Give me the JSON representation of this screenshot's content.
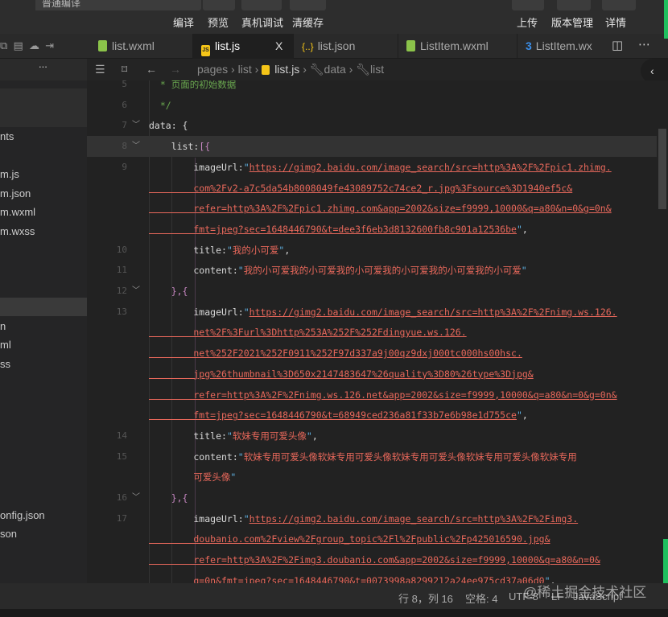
{
  "toolbar": {
    "mode": "普通编译",
    "buttons": [
      "编译",
      "预览",
      "真机调试",
      "清缓存"
    ],
    "right_buttons": [
      "上传",
      "版本管理",
      "详情"
    ]
  },
  "tabs": [
    {
      "label": "list.wxml",
      "icon": "wxml-file-icon",
      "color": "#8bc34a"
    },
    {
      "label": "list.js",
      "icon": "js-file-icon",
      "color": "#f5c518",
      "active": true
    },
    {
      "label": "list.json",
      "icon": "json-file-icon",
      "color": "#f5c518"
    },
    {
      "label": "ListItem.wxml",
      "icon": "wxml-file-icon",
      "color": "#8bc34a"
    },
    {
      "label": "ListItem.wx",
      "icon": "css-file-icon",
      "color": "#3b8ee8"
    }
  ],
  "tab_close": "X",
  "breadcrumb": [
    "pages",
    "list",
    "list.js",
    "data",
    "list"
  ],
  "sidebar": {
    "more": "...",
    "items": [
      "nts",
      "m.js",
      "m.json",
      "m.wxml",
      "m.wxss",
      "n",
      "ml",
      "ss",
      "onfig.json",
      "son"
    ]
  },
  "code": [
    {
      "n": "5",
      "t": [
        [
          "c",
          "  * 页面的初始数据"
        ]
      ]
    },
    {
      "n": "6",
      "t": [
        [
          "c",
          "  */"
        ]
      ]
    },
    {
      "n": "7",
      "f": true,
      "t": [
        [
          "p",
          "data: {"
        ]
      ]
    },
    {
      "n": "8",
      "f": true,
      "cur": true,
      "t": [
        [
          "p",
          "    list:"
        ],
        [
          "b",
          "[{"
        ]
      ]
    },
    {
      "n": "9",
      "t": [
        [
          "k",
          "        imageUrl:"
        ],
        [
          "q",
          "\""
        ],
        [
          "s",
          "https://gimg2.baidu.com/image_search/src=http%3A%2F%2Fpic1.zhimg."
        ]
      ]
    },
    {
      "t": [
        [
          "s",
          "        com%2Fv2-a7c5da54b8008049fe43089752c74ce2_r.jpg%3Fsource%3D1940ef5c&"
        ]
      ]
    },
    {
      "t": [
        [
          "s",
          "        refer=http%3A%2F%2Fpic1.zhimg.com&app=2002&size=f9999,10000&q=a80&n=0&g=0n&"
        ]
      ]
    },
    {
      "t": [
        [
          "s",
          "        fmt=jpeg?sec=1648446790&t=dee3f6eb3d8132600fb8c901a12536be"
        ],
        [
          "q",
          "\""
        ],
        [
          "p",
          ","
        ]
      ]
    },
    {
      "n": "10",
      "t": [
        [
          "k",
          "        title:"
        ],
        [
          "q",
          "\""
        ],
        [
          "sq",
          "我的小可爱"
        ],
        [
          "q",
          "\""
        ],
        [
          "p",
          ","
        ]
      ]
    },
    {
      "n": "11",
      "t": [
        [
          "k",
          "        content:"
        ],
        [
          "q",
          "\""
        ],
        [
          "sq",
          "我的小可爱我的小可爱我的小可爱我的小可爱我的小可爱我的小可爱"
        ],
        [
          "q",
          "\""
        ]
      ]
    },
    {
      "n": "12",
      "f": true,
      "t": [
        [
          "b",
          "    },{"
        ]
      ]
    },
    {
      "n": "13",
      "t": [
        [
          "k",
          "        imageUrl:"
        ],
        [
          "q",
          "\""
        ],
        [
          "s",
          "https://gimg2.baidu.com/image_search/src=http%3A%2F%2Fnimg.ws.126."
        ]
      ]
    },
    {
      "t": [
        [
          "s",
          "        net%2F%3Furl%3Dhttp%253A%252F%252Fdingyue.ws.126."
        ]
      ]
    },
    {
      "t": [
        [
          "s",
          "        net%252F2021%252F0911%252F97d337a9j00qz9dxj000tc000hs00hsc."
        ]
      ]
    },
    {
      "t": [
        [
          "s",
          "        jpg%26thumbnail%3D650x2147483647%26quality%3D80%26type%3Djpg&"
        ]
      ]
    },
    {
      "t": [
        [
          "s",
          "        refer=http%3A%2F%2Fnimg.ws.126.net&app=2002&size=f9999,10000&q=a80&n=0&g=0n&"
        ]
      ]
    },
    {
      "t": [
        [
          "s",
          "        fmt=jpeg?sec=1648446790&t=68949ced236a81f33b7e6b98e1d755ce"
        ],
        [
          "q",
          "\""
        ],
        [
          "p",
          ","
        ]
      ]
    },
    {
      "n": "14",
      "t": [
        [
          "k",
          "        title:"
        ],
        [
          "q",
          "\""
        ],
        [
          "sq",
          "软妹专用可爱头像"
        ],
        [
          "q",
          "\""
        ],
        [
          "p",
          ","
        ]
      ]
    },
    {
      "n": "15",
      "t": [
        [
          "k",
          "        content:"
        ],
        [
          "q",
          "\""
        ],
        [
          "sq",
          "软妹专用可爱头像软妹专用可爱头像软妹专用可爱头像软妹专用可爱头像软妹专用"
        ]
      ]
    },
    {
      "t": [
        [
          "sq",
          "        可爱头像"
        ],
        [
          "q",
          "\""
        ]
      ]
    },
    {
      "n": "16",
      "f": true,
      "t": [
        [
          "b",
          "    },{"
        ]
      ]
    },
    {
      "n": "17",
      "t": [
        [
          "k",
          "        imageUrl:"
        ],
        [
          "q",
          "\""
        ],
        [
          "s",
          "https://gimg2.baidu.com/image_search/src=http%3A%2F%2Fimg3."
        ]
      ]
    },
    {
      "t": [
        [
          "s",
          "        doubanio.com%2Fview%2Fgroup_topic%2Fl%2Fpublic%2Fp425016590.jpg&"
        ]
      ]
    },
    {
      "t": [
        [
          "s",
          "        refer=http%3A%2F%2Fimg3.doubanio.com&app=2002&size=f9999,10000&q=a80&n=0&"
        ]
      ]
    },
    {
      "t": [
        [
          "s",
          "        g=0n&fmt=jpeg?sec=1648446790&t=0073998a8299212a24ee975cd37a06d0"
        ],
        [
          "q",
          "\""
        ],
        [
          "p",
          ","
        ]
      ]
    }
  ],
  "status": {
    "position": "行 8，列 16",
    "indent": "空格: 4",
    "encoding": "UTF-8",
    "eol": "LF",
    "language": "JavaScript",
    "watermark": "@稀土掘金技术社区"
  }
}
